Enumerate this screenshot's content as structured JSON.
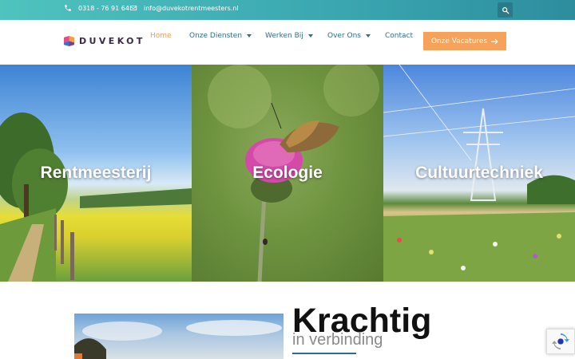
{
  "topbar": {
    "phone": "0318 - 76 91 64",
    "email": "info@duvekotrentmeesters.nl",
    "icons": [
      "phone-icon",
      "envelope-icon",
      "search-icon"
    ]
  },
  "header": {
    "logo_text": "DUVEKOT",
    "nav": [
      {
        "label": "Home",
        "active": true
      },
      {
        "label": "Onze Diensten",
        "dropdown": true
      },
      {
        "label": "Werken Bij",
        "dropdown": true
      },
      {
        "label": "Over Ons",
        "dropdown": true
      },
      {
        "label": "Contact"
      }
    ],
    "cta_label": "Onze Vacatures"
  },
  "services": [
    {
      "title": "Rentmeesterij"
    },
    {
      "title": "Ecologie"
    },
    {
      "title": "Cultuurtechniek"
    }
  ],
  "intro": {
    "heading": "Krachtig",
    "subheading": "in verbinding"
  },
  "colors": {
    "accent": "#f6a25a",
    "nav_text": "#2d6c8c",
    "topbar_start": "#4fc3be",
    "topbar_end": "#2d8d9e"
  }
}
